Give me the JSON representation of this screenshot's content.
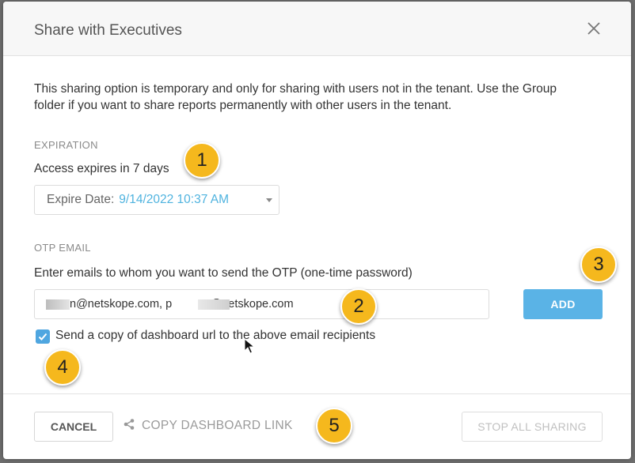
{
  "dialog": {
    "title": "Share with Executives",
    "description": "This sharing option is temporary and only for sharing with users not in the tenant. Use the Group folder if you want to share reports permanently with other users in the tenant."
  },
  "expiration": {
    "section_label": "EXPIRATION",
    "access_text": "Access expires in 7 days",
    "expire_label": "Expire Date:",
    "expire_value": "9/14/2022 10:37 AM"
  },
  "otp": {
    "section_label": "OTP EMAIL",
    "instruction": "Enter emails to whom you want to send the OTP (one-time password)",
    "emails_value": "n@netskope.com, p          a@netskope.com",
    "add_label": "ADD",
    "checkbox_checked": true,
    "checkbox_label": "Send a copy of dashboard url to the above email recipients"
  },
  "footer": {
    "cancel_label": "CANCEL",
    "copy_link_label": "COPY DASHBOARD LINK",
    "stop_label": "STOP ALL SHARING"
  },
  "badges": [
    "1",
    "2",
    "3",
    "4",
    "5"
  ],
  "colors": {
    "accent": "#5ab3e6",
    "badge": "#f5b81d"
  },
  "icons": [
    "close-icon",
    "chevron-down-icon",
    "checkmark-icon",
    "share-icon",
    "mouse-cursor-icon"
  ]
}
